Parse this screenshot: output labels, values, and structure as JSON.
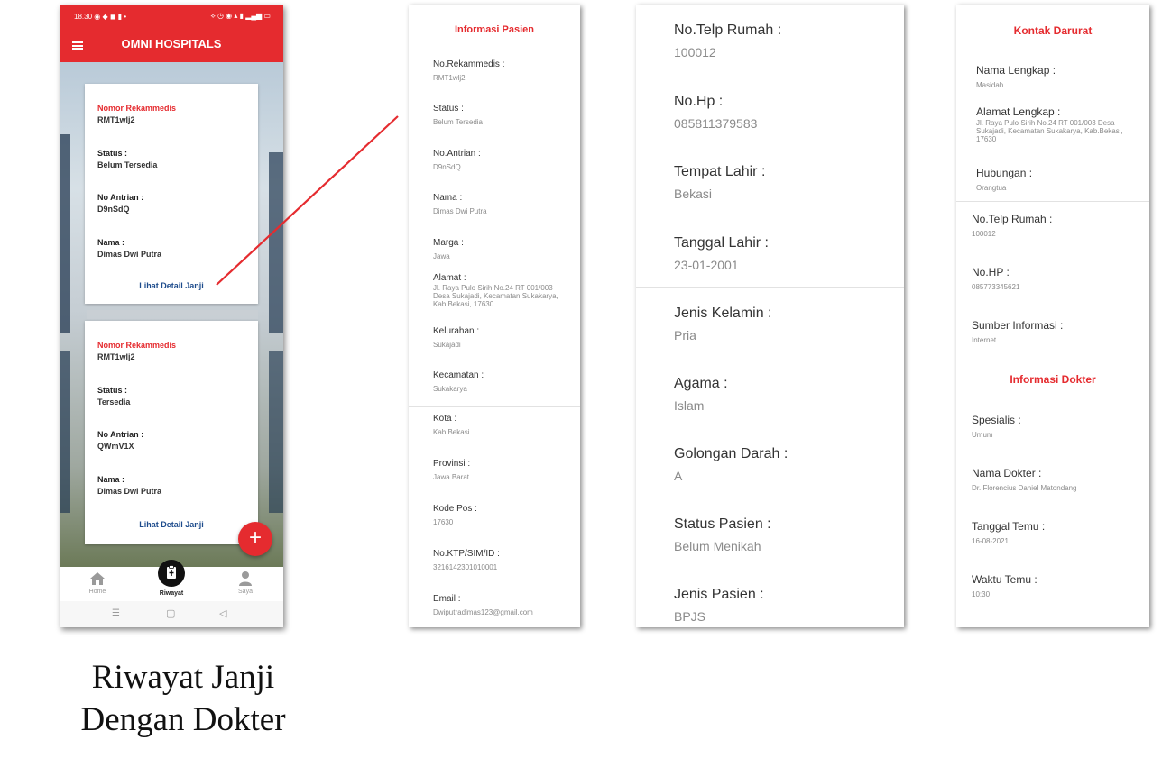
{
  "phone": {
    "status_bar": {
      "time": "18.30",
      "left_icons": "◉ ◆ ◼ ▮ •",
      "right_icons": "⟡ ◷ ◉ ▴ ▮ ▂▄▆ ▭"
    },
    "app_title": "OMNI HOSPITALS",
    "appointments": [
      {
        "record_label": "Nomor Rekammedis",
        "record_value": "RMT1wlj2",
        "status_label": "Status :",
        "status_value": "Belum Tersedia",
        "queue_label": "No Antrian :",
        "queue_value": "D9nSdQ",
        "name_label": "Nama :",
        "name_value": "Dimas Dwi Putra",
        "link": "Lihat Detail Janji"
      },
      {
        "record_label": "Nomor Rekammedis",
        "record_value": "RMT1wlj2",
        "status_label": "Status :",
        "status_value": "Tersedia",
        "queue_label": "No Antrian :",
        "queue_value": "QWmV1X",
        "name_label": "Nama :",
        "name_value": "Dimas Dwi Putra",
        "link": "Lihat Detail Janji"
      }
    ],
    "fab_label": "+",
    "bottom_nav": [
      {
        "label": "Home",
        "icon": "home-icon"
      },
      {
        "label": "Riwayat",
        "icon": "clipboard-icon",
        "active": true
      },
      {
        "label": "Saya",
        "icon": "person-icon"
      }
    ],
    "system_nav": {
      "menu": "☰",
      "home": "▢",
      "back": "◁"
    },
    "colors": {
      "brand": "#e52b2f",
      "link": "#1d4b8c"
    }
  },
  "caption": {
    "line1": "Riwayat Janji",
    "line2": "Dengan Dokter"
  },
  "patient_info": {
    "title": "Informasi Pasien",
    "fields": [
      {
        "label": "No.Rekammedis :",
        "value": "RMT1wlj2"
      },
      {
        "label": "Status :",
        "value": "Belum Tersedia"
      },
      {
        "label": "No.Antrian :",
        "value": "D9nSdQ"
      },
      {
        "label": "Nama :",
        "value": "Dimas Dwi Putra"
      },
      {
        "label": "Marga :",
        "value": "Jawa"
      },
      {
        "label": "Alamat :",
        "value": "Jl. Raya Pulo Sirih No.24 RT 001/003 Desa Sukajadi, Kecamatan Sukakarya, Kab.Bekasi, 17630"
      },
      {
        "label": "Kelurahan :",
        "value": "Sukajadi"
      },
      {
        "label": "Kecamatan :",
        "value": "Sukakarya"
      },
      {
        "label": "Kota :",
        "value": "Kab.Bekasi"
      },
      {
        "label": "Provinsi :",
        "value": "Jawa Barat"
      },
      {
        "label": "Kode Pos :",
        "value": "17630"
      },
      {
        "label": "No.KTP/SIM/ID :",
        "value": "3216142301010001"
      },
      {
        "label": "Email :",
        "value": "Dwiputradimas123@gmail.com"
      }
    ]
  },
  "contact_info": {
    "fields": [
      {
        "label": "No.Telp Rumah :",
        "value": "100012"
      },
      {
        "label": "No.Hp :",
        "value": "085811379583"
      },
      {
        "label": "Tempat Lahir :",
        "value": "Bekasi"
      },
      {
        "label": "Tanggal Lahir :",
        "value": "23-01-2001"
      },
      {
        "label": "Jenis Kelamin :",
        "value": "Pria"
      },
      {
        "label": "Agama :",
        "value": "Islam"
      },
      {
        "label": "Golongan Darah :",
        "value": "A"
      },
      {
        "label": "Status Pasien :",
        "value": "Belum Menikah"
      },
      {
        "label": "Jenis Pasien :",
        "value": "BPJS"
      }
    ]
  },
  "emergency_contact": {
    "title": "Kontak Darurat",
    "fields": [
      {
        "label": "Nama Lengkap :",
        "value": "Masidah"
      },
      {
        "label": "Alamat Lengkap :",
        "value": "Jl. Raya Pulo Sirih No.24 RT 001/003 Desa Sukajadi, Kecamatan Sukakarya, Kab.Bekasi, 17630"
      },
      {
        "label": "Hubungan :",
        "value": "Orangtua"
      },
      {
        "label": "No.Telp Rumah :",
        "value": "100012"
      },
      {
        "label": "No.HP :",
        "value": "085773345621"
      },
      {
        "label": "Sumber Informasi :",
        "value": "Internet"
      }
    ]
  },
  "doctor_info": {
    "title": "Informasi Dokter",
    "fields": [
      {
        "label": "Spesialis :",
        "value": "Umum"
      },
      {
        "label": "Nama Dokter :",
        "value": "Dr. Florencius Daniel Matondang"
      },
      {
        "label": "Tanggal Temu :",
        "value": "16-08-2021"
      },
      {
        "label": "Waktu Temu :",
        "value": "10:30"
      }
    ]
  }
}
